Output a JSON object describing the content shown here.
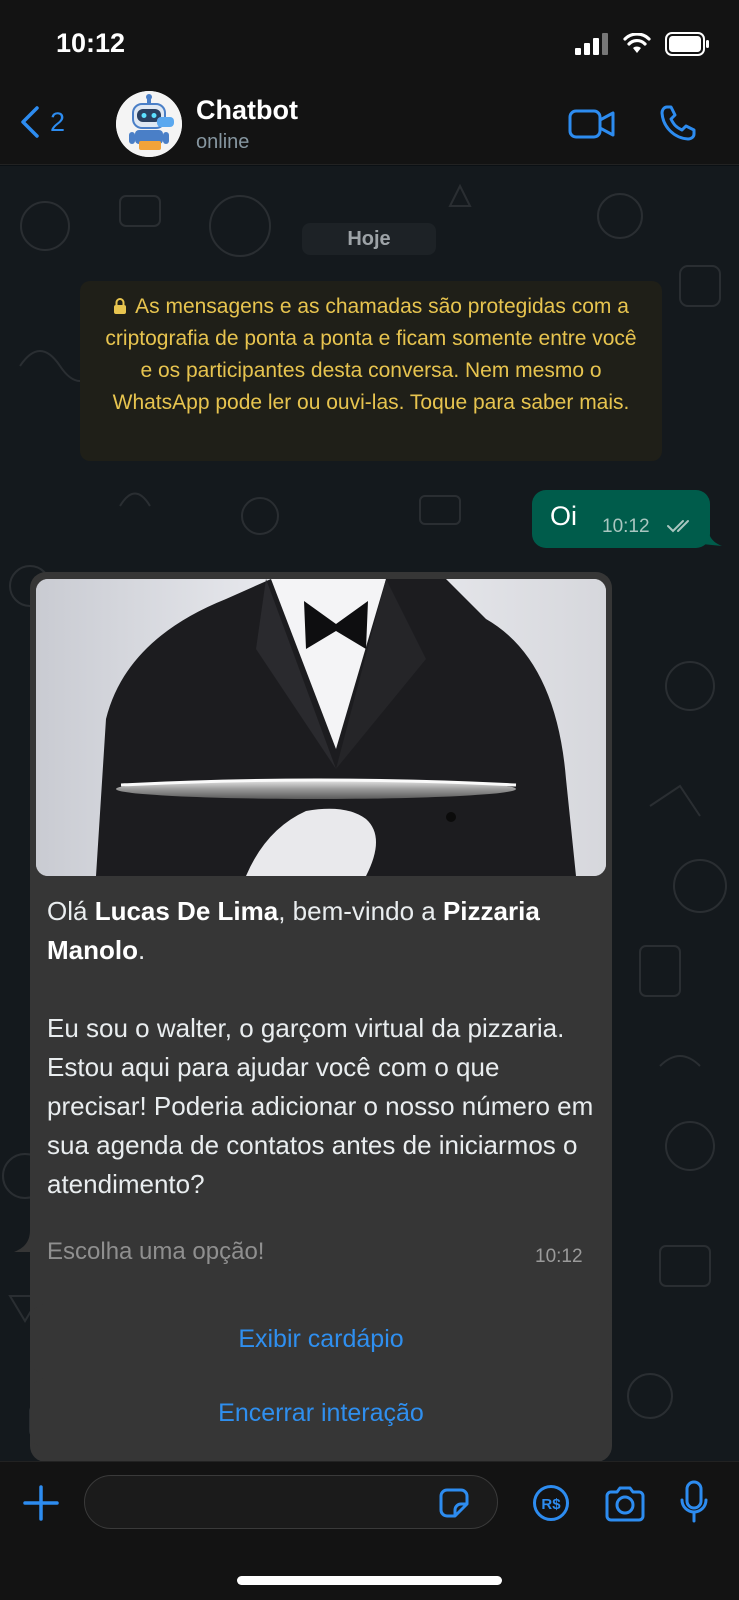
{
  "status_bar": {
    "time": "10:12"
  },
  "header": {
    "back_count": "2",
    "contact_name": "Chatbot",
    "contact_status": "online"
  },
  "chat": {
    "day_label": "Hoje",
    "encryption_notice": "As mensagens e as chamadas são protegidas com a criptografia de ponta a ponta e ficam somente entre você e os participantes desta conversa. Nem mesmo o WhatsApp pode ler ou ouvi-las. Toque para saber mais.",
    "outgoing": {
      "text": "Oi",
      "time": "10:12"
    },
    "incoming": {
      "greeting_prefix": "Olá ",
      "user_name": "Lucas De Lima",
      "greeting_mid": ", bem-vindo a ",
      "business_name": "Pizzaria Manolo",
      "greeting_end": ".",
      "body": "Eu sou o walter, o garçom virtual da pizzaria. Estou aqui para ajudar você com o que precisar! Poderia adicionar o nosso número em sua agenda de contatos antes de iniciarmos o atendimento?",
      "footer": "Escolha uma opção!",
      "time": "10:12"
    },
    "options": [
      {
        "label": "Exibir cardápio"
      },
      {
        "label": "Encerrar interação"
      }
    ]
  },
  "colors": {
    "accent_blue": "#2d8cf0",
    "outgoing_bubble": "#005c4b",
    "incoming_bubble": "#363636",
    "encryption_text": "#e7c44f"
  },
  "icons": [
    "signal-icon",
    "wifi-icon",
    "battery-icon",
    "chevron-left-icon",
    "video-call-icon",
    "phone-icon",
    "lock-icon",
    "double-check-icon",
    "plus-icon",
    "sticker-icon",
    "pix-payment-icon",
    "camera-icon",
    "microphone-icon"
  ]
}
